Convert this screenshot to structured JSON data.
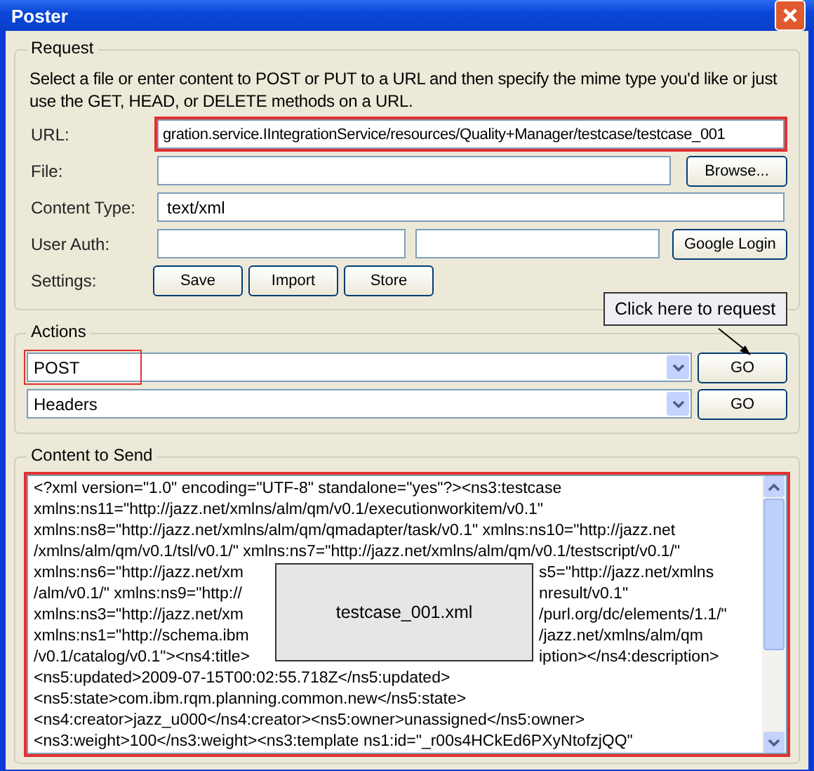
{
  "window": {
    "title": "Poster"
  },
  "request": {
    "legend": "Request",
    "description": "Select a file or enter content to POST or PUT to a URL and then specify the mime type you'd like or just use the GET, HEAD, or DELETE methods on a URL.",
    "url": {
      "label": "URL:",
      "value": "gration.service.IIntegrationService/resources/Quality+Manager/testcase/testcase_001",
      "highlighted": true
    },
    "file": {
      "label": "File:",
      "button": "Browse..."
    },
    "content_type": {
      "label": "Content Type:",
      "value": "text/xml"
    },
    "user_auth": {
      "label": "User Auth:",
      "button": "Google Login"
    },
    "settings": {
      "label": "Settings:",
      "buttons": [
        "Save",
        "Import",
        "Store"
      ]
    }
  },
  "actions": {
    "legend": "Actions",
    "rows": [
      {
        "value": "POST",
        "button": "GO",
        "highlighted": true
      },
      {
        "value": "Headers",
        "button": "GO",
        "highlighted": false
      }
    ]
  },
  "callout": {
    "text": "Click here to request"
  },
  "content": {
    "legend": "Content to Send",
    "highlighted": true,
    "overlay": {
      "text": "testcase_001.xml"
    },
    "lines": [
      {
        "kind": "full",
        "text": "<?xml version=\"1.0\" encoding=\"UTF-8\" standalone=\"yes\"?><ns3:testcase"
      },
      {
        "kind": "full",
        "text": "xmlns:ns11=\"http://jazz.net/xmlns/alm/qm/v0.1/executionworkitem/v0.1\""
      },
      {
        "kind": "full",
        "text": "xmlns:ns8=\"http://jazz.net/xmlns/alm/qm/qmadapter/task/v0.1\" xmlns:ns10=\"http://jazz.net"
      },
      {
        "kind": "full",
        "text": "/xmlns/alm/qm/v0.1/tsl/v0.1/\" xmlns:ns7=\"http://jazz.net/xmlns/alm/qm/v0.1/testscript/v0.1/\""
      },
      {
        "kind": "split",
        "left": "xmlns:ns6=\"http://jazz.net/xm",
        "right": "s5=\"http://jazz.net/xmlns"
      },
      {
        "kind": "split",
        "left": "/alm/v0.1/\" xmlns:ns9=\"http://",
        "right": "nresult/v0.1\""
      },
      {
        "kind": "split",
        "left": "xmlns:ns3=\"http://jazz.net/xm",
        "right": "/purl.org/dc/elements/1.1/\""
      },
      {
        "kind": "split",
        "left": "xmlns:ns1=\"http://schema.ibm",
        "right": "/jazz.net/xmlns/alm/qm"
      },
      {
        "kind": "split",
        "left": "/v0.1/catalog/v0.1\"><ns4:title>",
        "right": "iption></ns4:description>"
      },
      {
        "kind": "full",
        "text": "<ns5:updated>2009-07-15T00:02:55.718Z</ns5:updated>"
      },
      {
        "kind": "full",
        "text": "<ns5:state>com.ibm.rqm.planning.common.new</ns5:state>"
      },
      {
        "kind": "full",
        "text": "<ns4:creator>jazz_u000</ns4:creator><ns5:owner>unassigned</ns5:owner>"
      },
      {
        "kind": "full",
        "text": "<ns3:weight>100</ns3:weight><ns3:template ns1:id=\"_r00s4HCkEd6PXyNtofzjQQ\""
      }
    ]
  }
}
